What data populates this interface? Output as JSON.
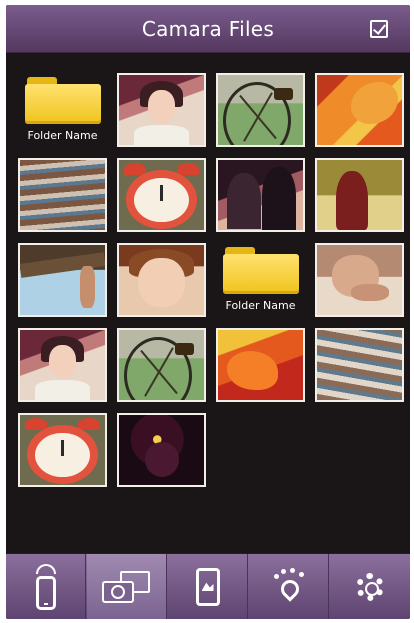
{
  "header": {
    "title": "Camara Files"
  },
  "grid": {
    "items": [
      {
        "type": "folder",
        "label": "Folder Name"
      },
      {
        "type": "photo",
        "icon": "girl-photo"
      },
      {
        "type": "photo",
        "icon": "bicycle-photo"
      },
      {
        "type": "photo",
        "icon": "flower-photo"
      },
      {
        "type": "photo",
        "icon": "reflection-photo"
      },
      {
        "type": "photo",
        "icon": "alarm-clock-photo"
      },
      {
        "type": "photo",
        "icon": "couple-photo"
      },
      {
        "type": "photo",
        "icon": "girl-red-coat-photo"
      },
      {
        "type": "photo",
        "icon": "tree-sky-photo"
      },
      {
        "type": "photo",
        "icon": "smiling-girl-photo"
      },
      {
        "type": "folder",
        "label": "Folder Name"
      },
      {
        "type": "photo",
        "icon": "child-photo"
      },
      {
        "type": "photo",
        "icon": "girl-photo"
      },
      {
        "type": "photo",
        "icon": "bicycle-photo"
      },
      {
        "type": "photo",
        "icon": "flower-photo"
      },
      {
        "type": "photo",
        "icon": "reflection-photo"
      },
      {
        "type": "photo",
        "icon": "alarm-clock-photo"
      },
      {
        "type": "photo",
        "icon": "dark-flower-photo"
      }
    ]
  },
  "tabbar": {
    "tabs": [
      {
        "icon": "phone-wifi-icon",
        "active": false
      },
      {
        "icon": "camera-photos-icon",
        "active": true
      },
      {
        "icon": "phone-gallery-icon",
        "active": false
      },
      {
        "icon": "location-icon",
        "active": false
      },
      {
        "icon": "gear-icon",
        "active": false
      }
    ]
  },
  "colors": {
    "header_bg": "#6a4d7c",
    "tabbar_bg": "#7a5f8e",
    "content_bg": "#1a1517",
    "folder": "#f5cc2a"
  }
}
